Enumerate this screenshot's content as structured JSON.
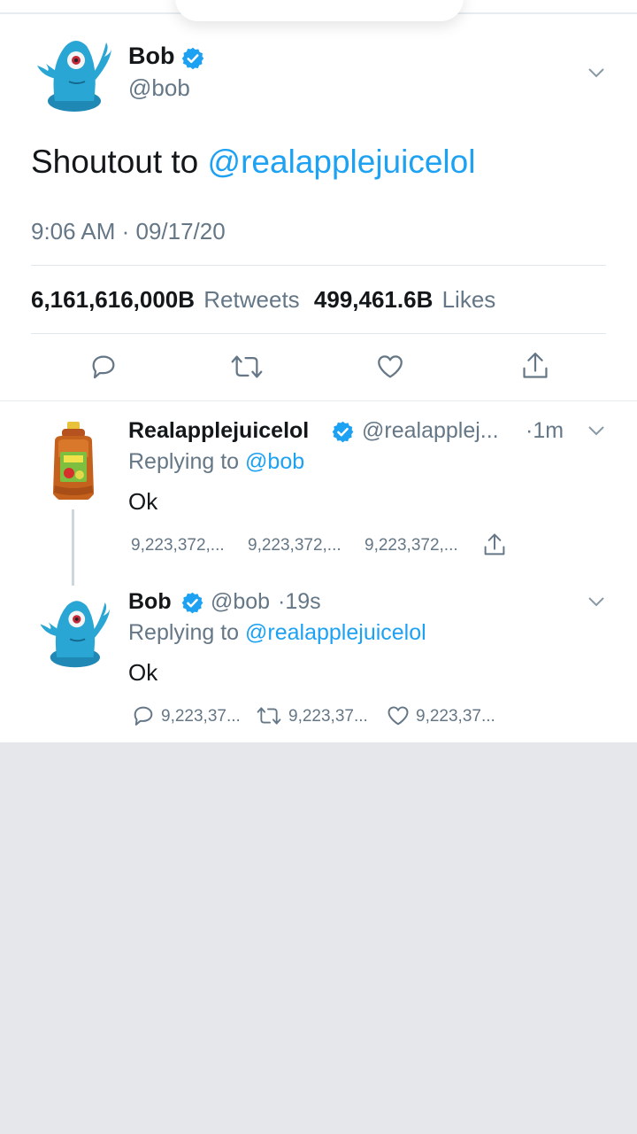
{
  "main_tweet": {
    "name": "Bob",
    "handle": "@bob",
    "text_prefix": "Shoutout to ",
    "text_mention": "@realapplejuicelol",
    "timestamp": "9:06 AM · 09/17/20",
    "retweets_count": "6,161,616,000B",
    "retweets_label": "Retweets",
    "likes_count": "499,461.6B",
    "likes_label": "Likes",
    "actions": [
      "reply-icon",
      "retweet-icon",
      "like-icon",
      "share-icon"
    ]
  },
  "replies": [
    {
      "name": "Realapplejuicelol",
      "handle": "@realapplej...",
      "time": "·1m",
      "replying_label": "Replying to",
      "replying_to": "@bob",
      "text": "Ok",
      "counts": [
        "9,223,372,...",
        "9,223,372,...",
        "9,223,372,..."
      ]
    },
    {
      "name": "Bob",
      "handle": "@bob",
      "time": "·19s",
      "replying_label": "Replying to",
      "replying_to": "@realapplejuicelol",
      "text": "Ok",
      "counts": [
        "9,223,37...",
        "9,223,37...",
        "9,223,37..."
      ]
    }
  ],
  "colors": {
    "accent": "#1da1f2",
    "secondary_text": "#657786",
    "primary_text": "#14171a",
    "divider": "#e1e8ed",
    "empty_background": "#e6e7eb"
  }
}
